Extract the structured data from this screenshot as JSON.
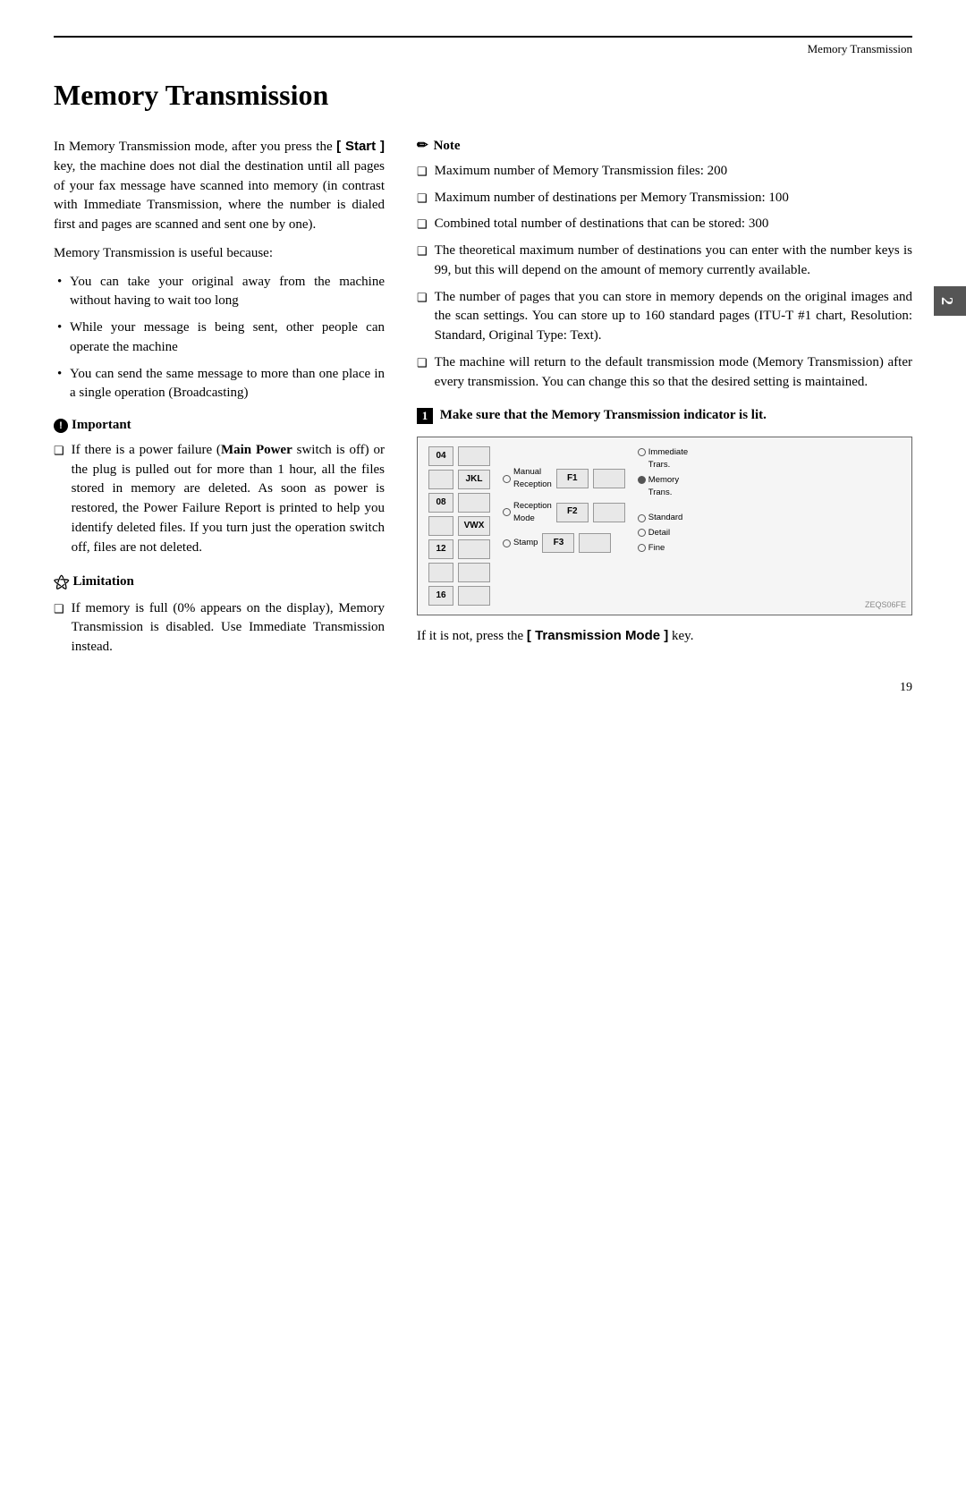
{
  "header": {
    "title": "Memory Transmission"
  },
  "chapter_tab": "2",
  "page_number": "19",
  "page_title": "Memory Transmission",
  "left_col": {
    "intro_para1": "In Memory Transmission mode, after you press the",
    "start_key": "[ Start ]",
    "intro_para1b": "key, the machine does not dial the destination until all pages of your fax message have scanned into memory (in contrast with Immediate Transmission, where the number is dialed first and pages are scanned and sent one by one).",
    "intro_para2": "Memory Transmission is useful because:",
    "bullets": [
      "You can take your original away from the machine without having to wait too long",
      "While your message is being sent, other people can operate the machine",
      "You can send the same message to more than one place in a single operation (Broadcasting)"
    ],
    "important": {
      "header": "Important",
      "items": [
        "If there is a power failure (Main Power switch is off) or the plug is pulled out for more than 1 hour, all the files stored in memory are deleted. As soon as power is restored, the Power Failure Report is printed to help you identify deleted files. If you turn just the operation switch off, files are not deleted."
      ],
      "bold_phrases": [
        "Main Power"
      ]
    },
    "limitation": {
      "header": "Limitation",
      "items": [
        "If memory is full (0% appears on the display), Memory Transmission is disabled. Use Immediate Transmission instead."
      ]
    }
  },
  "right_col": {
    "note": {
      "header": "Note",
      "items": [
        "Maximum number of Memory Transmission files: 200",
        "Maximum number of destinations per Memory Transmission: 100",
        "Combined total number of destinations that can be stored: 300",
        "The theoretical maximum number of destinations you can enter with the number keys is 99, but this will depend on the amount of memory currently available.",
        "The number of pages that you can store in memory depends on the original images and the scan settings. You can store up to 160 standard pages (ITU-T #1 chart, Resolution: Standard, Original Type: Text).",
        "The machine will return to the default transmission mode (Memory Transmission) after every transmission. You can change this so that the desired setting is maintained."
      ]
    },
    "step1": {
      "num": "1",
      "text": "Make sure that the Memory Transmission indicator is lit."
    },
    "panel": {
      "keys_left": [
        {
          "num": "04",
          "alpha": ""
        },
        {
          "num": "",
          "alpha": "JKL"
        },
        {
          "num": "08",
          "alpha": ""
        },
        {
          "num": "",
          "alpha": "VWX"
        },
        {
          "num": "12",
          "alpha": ""
        },
        {
          "num": "",
          "alpha": ""
        },
        {
          "num": "16",
          "alpha": ""
        }
      ],
      "radio_left": [
        {
          "label": "Manual\nReception",
          "filled": false
        },
        {
          "label": "Reception\nMode",
          "filled": false
        }
      ],
      "fx_keys": [
        "F1",
        "F2",
        "F3"
      ],
      "radio_right_top": [
        {
          "label": "Immediate\nTrans.",
          "filled": false
        },
        {
          "label": "Memory\nTrans.",
          "filled": true
        }
      ],
      "radio_right_bottom": [
        {
          "label": "Standard",
          "filled": false
        },
        {
          "label": "Detail",
          "filled": false
        },
        {
          "label": "Fine",
          "filled": false
        }
      ],
      "stamp_radio": {
        "label": "Stamp",
        "filled": false
      },
      "ref": "ZEQS06FE"
    },
    "follow_up_para1": "If it is not, press the",
    "transmission_mode_key": "[ Transmission Mode ]",
    "follow_up_para2": "key."
  }
}
